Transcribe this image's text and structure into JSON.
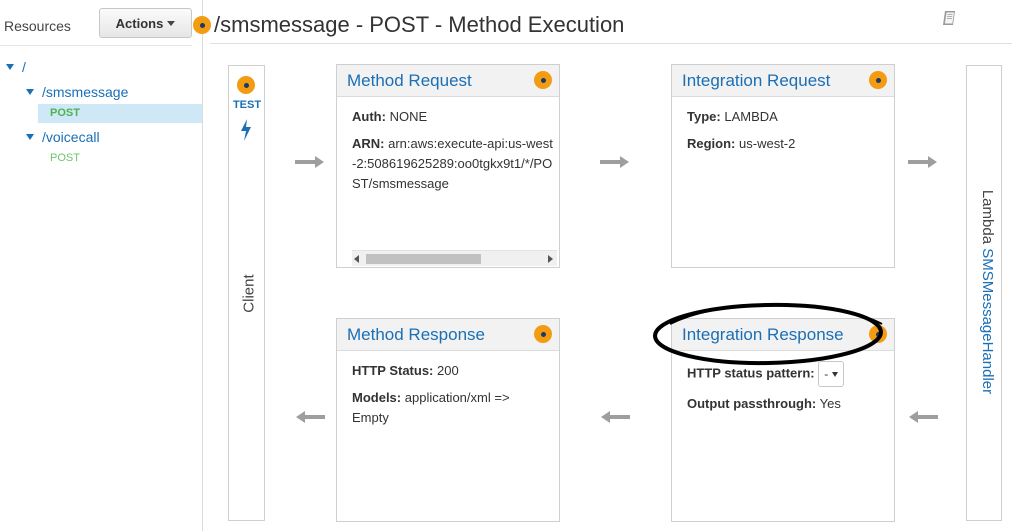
{
  "sidebar": {
    "title": "Resources",
    "actions_label": "Actions",
    "tree": {
      "root": "/",
      "sms": "/smsmessage",
      "sms_post": "POST",
      "voice": "/voicecall",
      "voice_post": "POST"
    }
  },
  "header": {
    "title": "/smsmessage - POST - Method Execution"
  },
  "client": {
    "test_label": "TEST",
    "label": "Client"
  },
  "method_request": {
    "title": "Method Request",
    "auth_label": "Auth:",
    "auth_value": "NONE",
    "arn_label": "ARN:",
    "arn_value": "arn:aws:execute-api:us-west-2:508619625289:oo0tgkx9t1/*/POST/smsmessage"
  },
  "integration_request": {
    "title": "Integration Request",
    "type_label": "Type:",
    "type_value": "LAMBDA",
    "region_label": "Region:",
    "region_value": "us-west-2"
  },
  "method_response": {
    "title": "Method Response",
    "status_label": "HTTP Status:",
    "status_value": "200",
    "models_label": "Models:",
    "models_value": "application/xml => Empty"
  },
  "integration_response": {
    "title": "Integration Response",
    "pattern_label": "HTTP status pattern:",
    "pattern_value": "-",
    "passthrough_label": "Output passthrough:",
    "passthrough_value": "Yes"
  },
  "lambda": {
    "prefix": "Lambda",
    "function_name": "SMSMessageHandler"
  },
  "colors": {
    "accent_blue": "#1a6fb5",
    "status_dot": "#f39c12",
    "method_green": "#4db24f",
    "selected_bg": "#cfe8f7"
  },
  "icons": [
    "orange-status-dot",
    "lightning-bolt-icon",
    "book-icon",
    "arrow-right-icon",
    "arrow-left-icon"
  ]
}
